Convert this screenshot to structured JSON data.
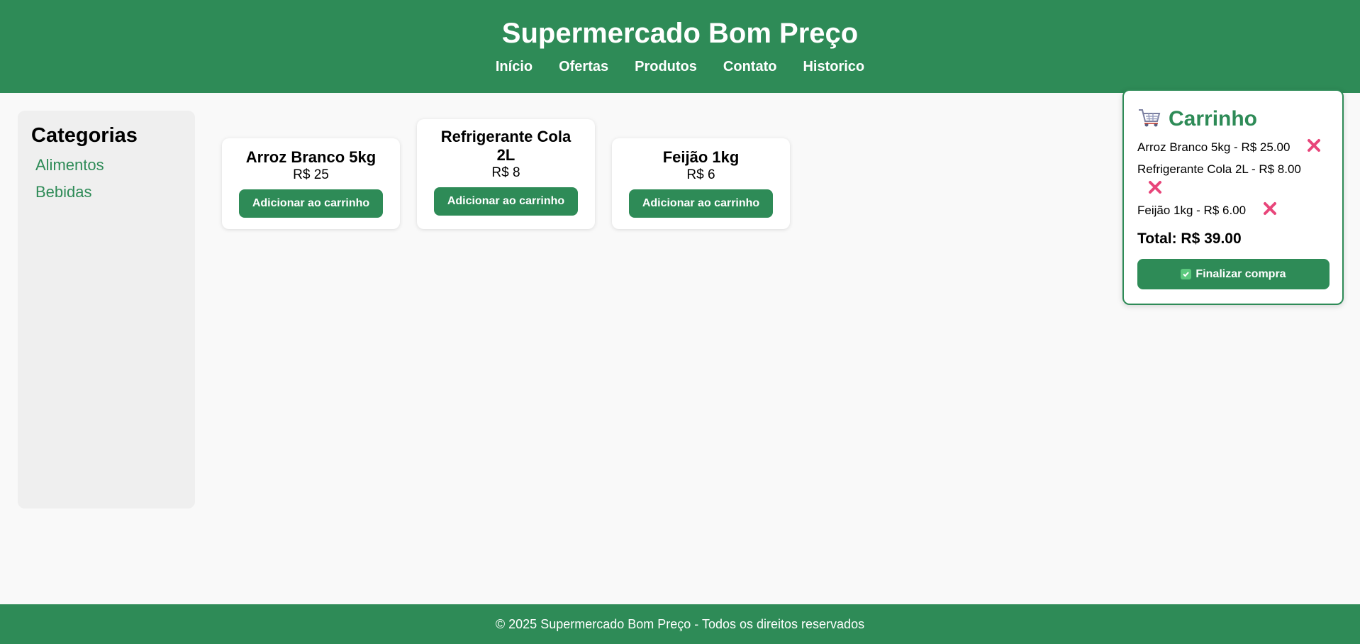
{
  "header": {
    "title": "Supermercado Bom Preço",
    "nav": [
      "Início",
      "Ofertas",
      "Produtos",
      "Contato",
      "Historico"
    ]
  },
  "sidebar": {
    "title": "Categorias",
    "items": [
      "Alimentos",
      "Bebidas"
    ]
  },
  "products": [
    {
      "name": "Arroz Branco 5kg",
      "price": "R$ 25",
      "button": "Adicionar ao carrinho"
    },
    {
      "name": "Refrigerante Cola 2L",
      "price": "R$ 8",
      "button": "Adicionar ao carrinho"
    },
    {
      "name": "Feijão 1kg",
      "price": "R$ 6",
      "button": "Adicionar ao carrinho"
    }
  ],
  "cart": {
    "title": "Carrinho",
    "icon": "shopping-cart-icon",
    "items": [
      {
        "text": "Arroz Branco 5kg - R$ 25.00",
        "remove_icon": "remove-x-icon"
      },
      {
        "text": "Refrigerante Cola 2L - R$ 8.00",
        "remove_icon": "remove-x-icon"
      },
      {
        "text": "Feijão 1kg - R$ 6.00",
        "remove_icon": "remove-x-icon"
      }
    ],
    "total": "Total: R$ 39.00",
    "checkout_label": "Finalizar compra",
    "checkout_icon": "check-box-icon"
  },
  "footer": {
    "text": "© 2025 Supermercado Bom Preço - Todos os direitos reservados"
  },
  "colors": {
    "brand": "#2e8b57",
    "remove": "#e8457a",
    "background": "#f9f9f9",
    "sidebar": "#efefef"
  }
}
